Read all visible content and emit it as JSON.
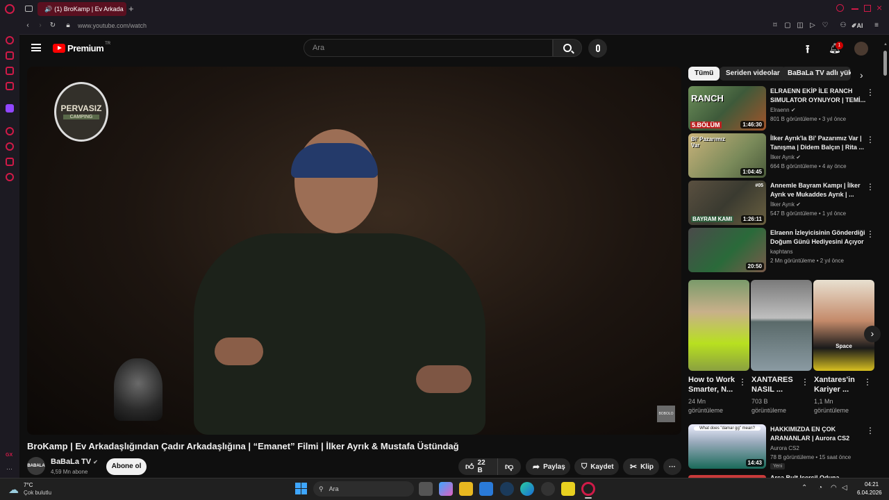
{
  "browser": {
    "tab_title": "(1) BroKamp | Ev Arkada",
    "url": "www.youtube.com/watch",
    "ai_label": "AI",
    "sidebar_bottom": "GX"
  },
  "youtube": {
    "logo": "Premium",
    "logo_region": "TR",
    "search_placeholder": "Ara",
    "notification_count": "1"
  },
  "video": {
    "watermark_top": "PERVASIZ",
    "watermark_sub": "CAMPING",
    "watermark_corner": "BOBOLO",
    "title": "BroKamp | Ev Arkadaşlığından Çadır Arkadaşlığına | “Emanet” Filmi | İlker Ayrık & Mustafa Üstündağ",
    "channel": "BaBaLa TV",
    "channel_avatar_text": "BABALA",
    "subscribers": "4,59 Mn abone",
    "subscribe_label": "Abone ol",
    "likes": "22 B",
    "share_label": "Paylaş",
    "save_label": "Kaydet",
    "clip_label": "Klip"
  },
  "chips": [
    "Tümü",
    "Seriden videolar",
    "BaBaLa TV adlı yükle"
  ],
  "recommendations": [
    {
      "title": "ELRAENN EKİP İLE RANCH SIMULATOR OYNUYOR | TEMİ...",
      "channel": "Elraenn",
      "meta": "801 B görüntüleme • 3 yıl önce",
      "duration": "1:46:30",
      "thumb_text": "RANCH",
      "thumb_text2": "5.BÖLÜM"
    },
    {
      "title": "İlker Ayrık'la Bi' Pazarımız Var | Tanışma | Didem Balçın | Rita ...",
      "channel": "İlker Ayrık",
      "meta": "664 B görüntüleme • 4 ay önce",
      "duration": "1:04:45",
      "thumb_text": "Bi' Pazarımız Var",
      "thumb_text2": ""
    },
    {
      "title": "Annemle Bayram Kampı | İlker Ayrık ve Mukaddes Ayrık | ...",
      "channel": "İlker Ayrık",
      "meta": "547 B görüntüleme • 1 yıl önce",
      "duration": "1:26:11",
      "thumb_text": "#05",
      "thumb_text2": "BAYRAM KAMI"
    },
    {
      "title": "Elraenn İzleyicisinin Gönderdiği Doğum Günü Hediyesini Açıyor",
      "channel": "kaphtans",
      "meta": "2 Mn görüntüleme • 2 yıl önce",
      "duration": "20:50",
      "thumb_text": "",
      "thumb_text2": ""
    }
  ],
  "shorts": [
    {
      "title": "How to Work Smarter, N...",
      "views": "24 Mn görüntüleme",
      "overlay": ""
    },
    {
      "title": "XANTARES NASIL ...",
      "views": "703 B görüntüleme",
      "overlay": ""
    },
    {
      "title": "Xantares'in Kariyer ...",
      "views": "1,1 Mn görüntüleme",
      "overlay": "Space"
    }
  ],
  "rec5": {
    "title": "HAKKIMIZDA EN ÇOK ARANANLAR | Aurora CS2",
    "channel": "Aurora CS2",
    "meta": "78 B görüntüleme • 15 saat önce",
    "badge": "Yeni",
    "duration": "14:43",
    "thumb_text": "What does \"damar gg\" mean?"
  },
  "rec6_partial": "Arca Bult İçerçil Oduna",
  "taskbar": {
    "temp": "7°C",
    "weather": "Çok bulutlu",
    "search": "Ara",
    "time": "04:21",
    "date": "6.04.2026"
  }
}
